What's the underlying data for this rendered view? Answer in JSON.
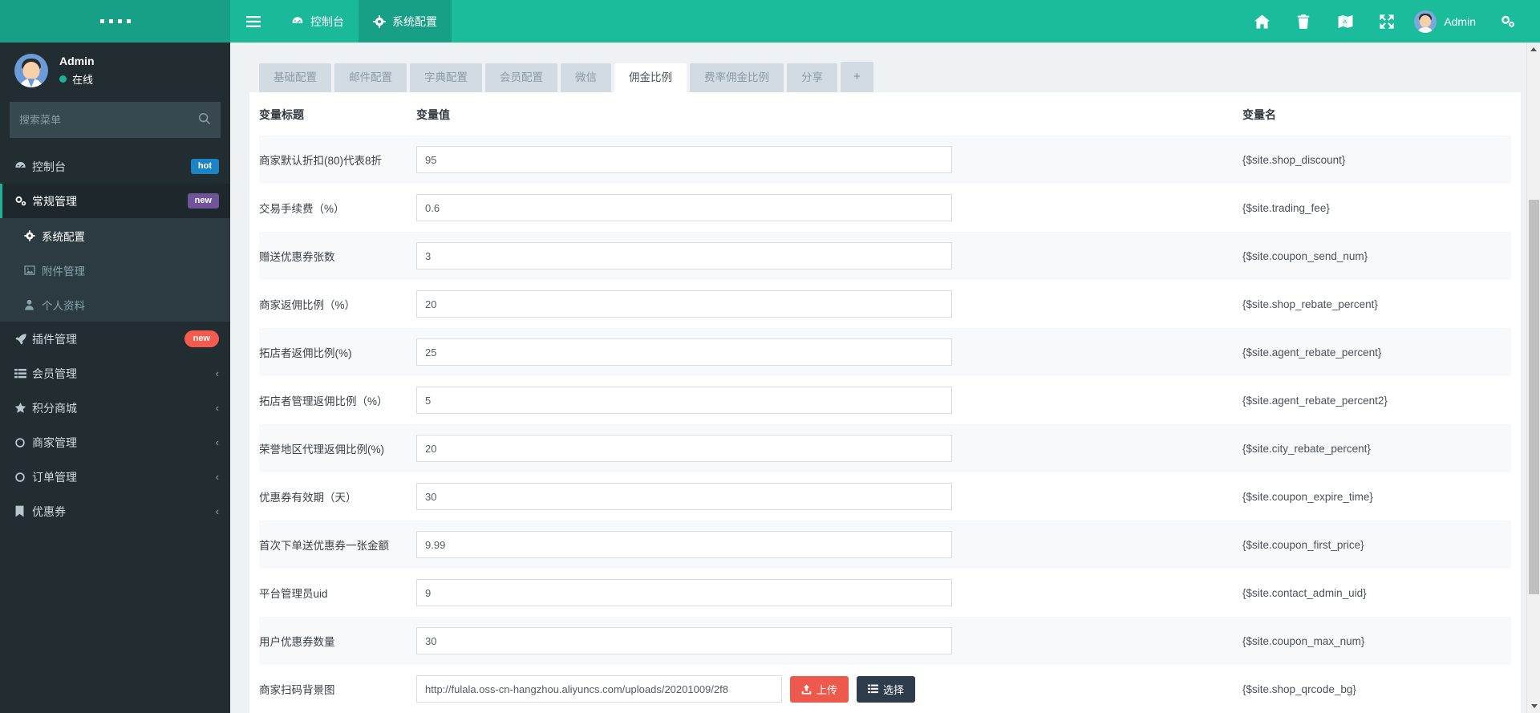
{
  "sidebar": {
    "logo": "....",
    "profile": {
      "name": "Admin",
      "status": "在线"
    },
    "search": {
      "placeholder": "搜索菜单",
      "value": ""
    },
    "items": [
      {
        "label": "控制台",
        "icon": "dashboard-icon",
        "badge": "hot",
        "badge_type": "hot"
      },
      {
        "label": "常规管理",
        "icon": "gears-icon",
        "badge": "new",
        "badge_type": "purple"
      },
      {
        "label": "系统配置",
        "icon": "gear-icon",
        "sub": true,
        "active": true
      },
      {
        "label": "附件管理",
        "icon": "image-icon",
        "sub": true
      },
      {
        "label": "个人资料",
        "icon": "user-icon",
        "sub": true
      },
      {
        "label": "插件管理",
        "icon": "rocket-icon",
        "badge": "new",
        "badge_type": "red"
      },
      {
        "label": "会员管理",
        "icon": "list-icon",
        "chevron": "‹"
      },
      {
        "label": "积分商城",
        "icon": "star-icon",
        "chevron": "‹"
      },
      {
        "label": "商家管理",
        "icon": "circle-icon",
        "chevron": "‹"
      },
      {
        "label": "订单管理",
        "icon": "circle-icon",
        "chevron": "‹"
      },
      {
        "label": "优惠券",
        "icon": "bookmark-icon",
        "chevron": "‹"
      }
    ]
  },
  "topbar": {
    "burger": "menu-icon",
    "links": [
      {
        "label": "控制台",
        "icon": "dashboard-icon",
        "active": false
      },
      {
        "label": "系统配置",
        "icon": "gear-icon",
        "active": true
      }
    ],
    "icons": [
      "home-icon",
      "trash-icon",
      "theme-icon",
      "fullscreen-icon"
    ],
    "user": "Admin",
    "settings_icon": "gears-icon"
  },
  "tabs": [
    {
      "label": "基础配置",
      "active": false
    },
    {
      "label": "邮件配置",
      "active": false
    },
    {
      "label": "字典配置",
      "active": false
    },
    {
      "label": "会员配置",
      "active": false
    },
    {
      "label": "微信",
      "active": false
    },
    {
      "label": "佣金比例",
      "active": true
    },
    {
      "label": "费率佣金比例",
      "active": false
    },
    {
      "label": "分享",
      "active": false
    },
    {
      "label": "+",
      "active": false
    }
  ],
  "table": {
    "headers": [
      "变量标题",
      "变量值",
      "变量名"
    ],
    "rows": [
      {
        "title": "商家默认折扣(80)代表8折",
        "value": "95",
        "name": "{$site.shop_discount}"
      },
      {
        "title": "交易手续费（%）",
        "value": "0.6",
        "name": "{$site.trading_fee}"
      },
      {
        "title": "赠送优惠券张数",
        "value": "3",
        "name": "{$site.coupon_send_num}"
      },
      {
        "title": "商家返佣比例（%）",
        "value": "20",
        "name": "{$site.shop_rebate_percent}"
      },
      {
        "title": "拓店者返佣比例(%)",
        "value": "25",
        "name": "{$site.agent_rebate_percent}"
      },
      {
        "title": "拓店者管理返佣比例（%）",
        "value": "5",
        "name": "{$site.agent_rebate_percent2}"
      },
      {
        "title": "荣誉地区代理返佣比例(%)",
        "value": "20",
        "name": "{$site.city_rebate_percent}"
      },
      {
        "title": "优惠券有效期（天）",
        "value": "30",
        "name": "{$site.coupon_expire_time}"
      },
      {
        "title": "首次下单送优惠券一张金额",
        "value": "9.99",
        "name": "{$site.coupon_first_price}"
      },
      {
        "title": "平台管理员uid",
        "value": "9",
        "name": "{$site.contact_admin_uid}"
      },
      {
        "title": "用户优惠券数量",
        "value": "30",
        "name": "{$site.coupon_max_num}"
      },
      {
        "title": "商家扫码背景图",
        "value": "http://fulala.oss-cn-hangzhou.aliyuncs.com/uploads/20201009/2f8",
        "name": "{$site.shop_qrcode_bg}",
        "upload": true
      }
    ],
    "upload_label": "上传",
    "select_label": "选择"
  },
  "colors": {
    "brand": "#1abc9c",
    "brand_dark": "#17a086",
    "sidebar": "#222d32",
    "sidebar_sub": "#2c3b41",
    "upload_btn": "#ed5a4d",
    "select_btn": "#2e3c4c"
  }
}
